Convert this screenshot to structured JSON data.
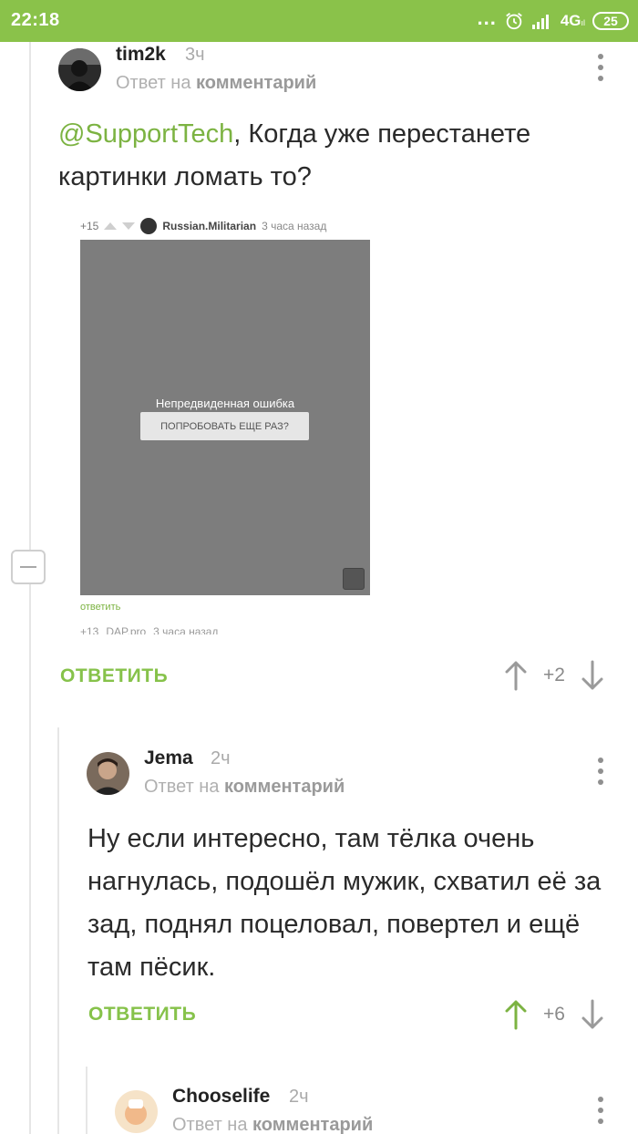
{
  "status_bar": {
    "time": "22:18",
    "dots": "...",
    "network": "4G",
    "network_sub": "ıl",
    "battery": "25"
  },
  "comments": [
    {
      "author": "tim2k",
      "time": "3ч",
      "reply_prefix": "Ответ на",
      "reply_target": "комментарий",
      "mention": "@SupportTech",
      "text": ", Когда уже перестанете картинки ломать то?",
      "reply_label": "ОТВЕТИТЬ",
      "score": "+2",
      "embed": {
        "score": "+15",
        "author": "Russian.Militarian",
        "ago": "3 часа назад",
        "error_text": "Непредвиденная ошибка",
        "retry_label": "ПОПРОБОВАТЬ ЕЩЕ РАЗ?",
        "reply_label": "ответить",
        "next_score": "+13",
        "next_author": "DAP.pro",
        "next_ago": "3 часа назад"
      }
    },
    {
      "author": "Jema",
      "time": "2ч",
      "reply_prefix": "Ответ на",
      "reply_target": "комментарий",
      "text": "Ну если интересно, там тёлка очень нагнулась, подошёл мужик, схватил её за зад, поднял поцеловал, повертел и ещё там пёсик.",
      "reply_label": "ОТВЕТИТЬ",
      "score": "+6"
    },
    {
      "author": "Chooselife",
      "time": "2ч",
      "reply_prefix": "Ответ на",
      "reply_target": "комментарий"
    }
  ],
  "colors": {
    "accent": "#8ac24a",
    "link": "#7cb342",
    "upvoted": "#7cb342",
    "neutral_arrow": "#9a9a9a"
  }
}
